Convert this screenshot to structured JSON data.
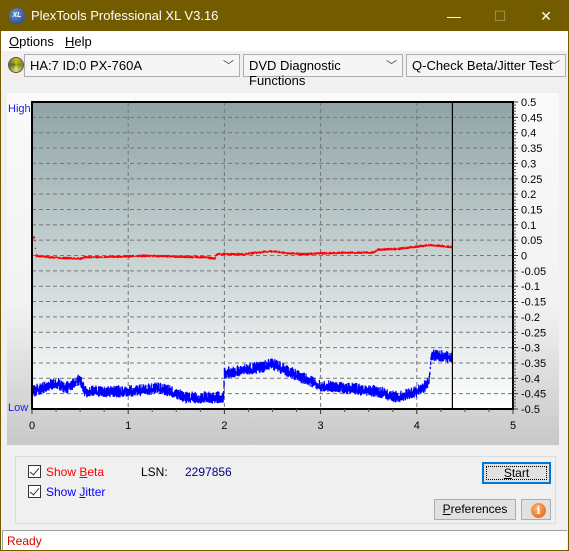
{
  "window": {
    "title": "PlexTools Professional XL V3.16",
    "icon": "xl-app-icon",
    "icon_text": "XL",
    "controls": {
      "minimize": "—",
      "maximize": "☐",
      "close": "✕"
    }
  },
  "menu": {
    "items": [
      {
        "label": "Options",
        "accel": "O",
        "rest": "ptions"
      },
      {
        "label": "Help",
        "accel": "H",
        "rest": "elp"
      }
    ]
  },
  "toolbar": {
    "drive_select": "HA:7 ID:0  PX-760A",
    "function_select": "DVD Diagnostic Functions",
    "test_select": "Q-Check Beta/Jitter Test",
    "chevron": "﹀"
  },
  "chart_data": {
    "type": "line",
    "title": "",
    "xlabel": "",
    "ylabel": "",
    "left_axis_labels": {
      "top": "High",
      "bottom": "Low"
    },
    "x_ticks": [
      "0",
      "1",
      "2",
      "3",
      "4",
      "5"
    ],
    "xlim": [
      0,
      5
    ],
    "ylim": [
      -0.5,
      0.5
    ],
    "y_ticks": [
      "0.5",
      "0.45",
      "0.4",
      "0.35",
      "0.3",
      "0.25",
      "0.2",
      "0.15",
      "0.1",
      "0.05",
      "0",
      "-0.05",
      "-0.1",
      "-0.15",
      "-0.2",
      "-0.25",
      "-0.3",
      "-0.35",
      "-0.4",
      "-0.45",
      "-0.5"
    ],
    "grid": true,
    "cursor_x": 4.37,
    "colors": {
      "beta": "#ff0000",
      "jitter": "#0000ff",
      "plot_top": "#8fa4a6",
      "plot_bottom": "#ffffff"
    },
    "series": [
      {
        "name": "Beta",
        "noise": 0.006,
        "x": [
          0,
          0.03,
          0.04,
          0.2,
          0.5,
          0.55,
          0.9,
          1.2,
          1.5,
          1.8,
          1.9,
          1.92,
          2.2,
          2.4,
          2.5,
          2.6,
          2.8,
          3.0,
          3.3,
          3.55,
          3.6,
          3.8,
          4.0,
          4.15,
          4.37
        ],
        "values": [
          0.06,
          0.06,
          0.0,
          -0.005,
          -0.01,
          -0.005,
          -0.003,
          0.0,
          -0.003,
          -0.005,
          -0.01,
          0.005,
          0.005,
          0.012,
          0.015,
          0.01,
          0.005,
          0.008,
          0.01,
          0.01,
          0.02,
          0.022,
          0.03,
          0.035,
          0.028
        ]
      },
      {
        "name": "Jitter",
        "noise": 0.025,
        "x": [
          0,
          0.1,
          0.25,
          0.35,
          0.5,
          0.55,
          0.7,
          1.0,
          1.3,
          1.45,
          1.6,
          1.99,
          2.0,
          2.2,
          2.4,
          2.5,
          2.7,
          3.0,
          3.3,
          3.6,
          3.8,
          4.0,
          4.1,
          4.13,
          4.15,
          4.37
        ],
        "values": [
          -0.44,
          -0.43,
          -0.41,
          -0.43,
          -0.4,
          -0.44,
          -0.44,
          -0.44,
          -0.43,
          -0.44,
          -0.46,
          -0.46,
          -0.38,
          -0.37,
          -0.36,
          -0.35,
          -0.38,
          -0.42,
          -0.43,
          -0.44,
          -0.46,
          -0.44,
          -0.42,
          -0.4,
          -0.32,
          -0.33
        ]
      }
    ]
  },
  "options": {
    "show_beta": {
      "label_pre": "Show ",
      "accel": "B",
      "label_post": "eta",
      "checked": true,
      "color": "#ff0000"
    },
    "show_jitter": {
      "label_pre": "Show ",
      "accel": "J",
      "label_post": "itter",
      "checked": true,
      "color": "#0000ff"
    },
    "lsn_label": "LSN:",
    "lsn_value": "2297856"
  },
  "buttons": {
    "start": {
      "accel": "S",
      "rest": "tart"
    },
    "preferences": {
      "accel": "P",
      "rest": "references"
    },
    "info": "i"
  },
  "status": {
    "text": "Ready"
  }
}
